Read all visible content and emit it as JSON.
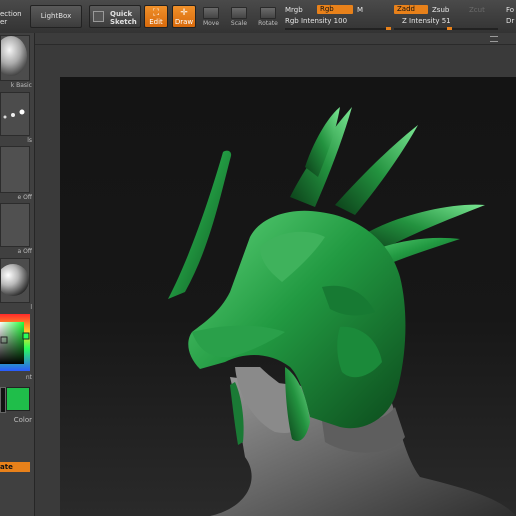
{
  "toolbar": {
    "projection_master_label": "ection",
    "projection_master_sub": "er",
    "lightbox_label": "LightBox",
    "quick_sketch_label": "Quick\nSketch",
    "edit_label": "Edit",
    "draw_label": "Draw",
    "move_label": "Move",
    "scale_label": "Scale",
    "rotate_label": "Rotate",
    "mrgb_label": "Mrgb",
    "rgb_label": "Rgb",
    "m_label": "M",
    "zadd_label": "Zadd",
    "zsub_label": "Zsub",
    "zcut_label": "Zcut",
    "fo_label": "Fo",
    "dr_label": "Dr",
    "rgb_intensity_label": "Rgb Intensity 100",
    "rgb_intensity_value": 100,
    "z_intensity_label": "Z Intensity 51",
    "z_intensity_value": 51
  },
  "leftpanel": {
    "material_label": "k Basic",
    "alpha_label": "ls",
    "texture_off_label": "e Off",
    "alpha_off_label": "a Off",
    "matcap_label": "l",
    "gradient_label": "nt",
    "color_label": "Color",
    "switch_label": "ate",
    "main_color": "#1fbe4a"
  },
  "viewport": {
    "helmet_color": "#1f8a3a",
    "background_top": "#141414"
  }
}
